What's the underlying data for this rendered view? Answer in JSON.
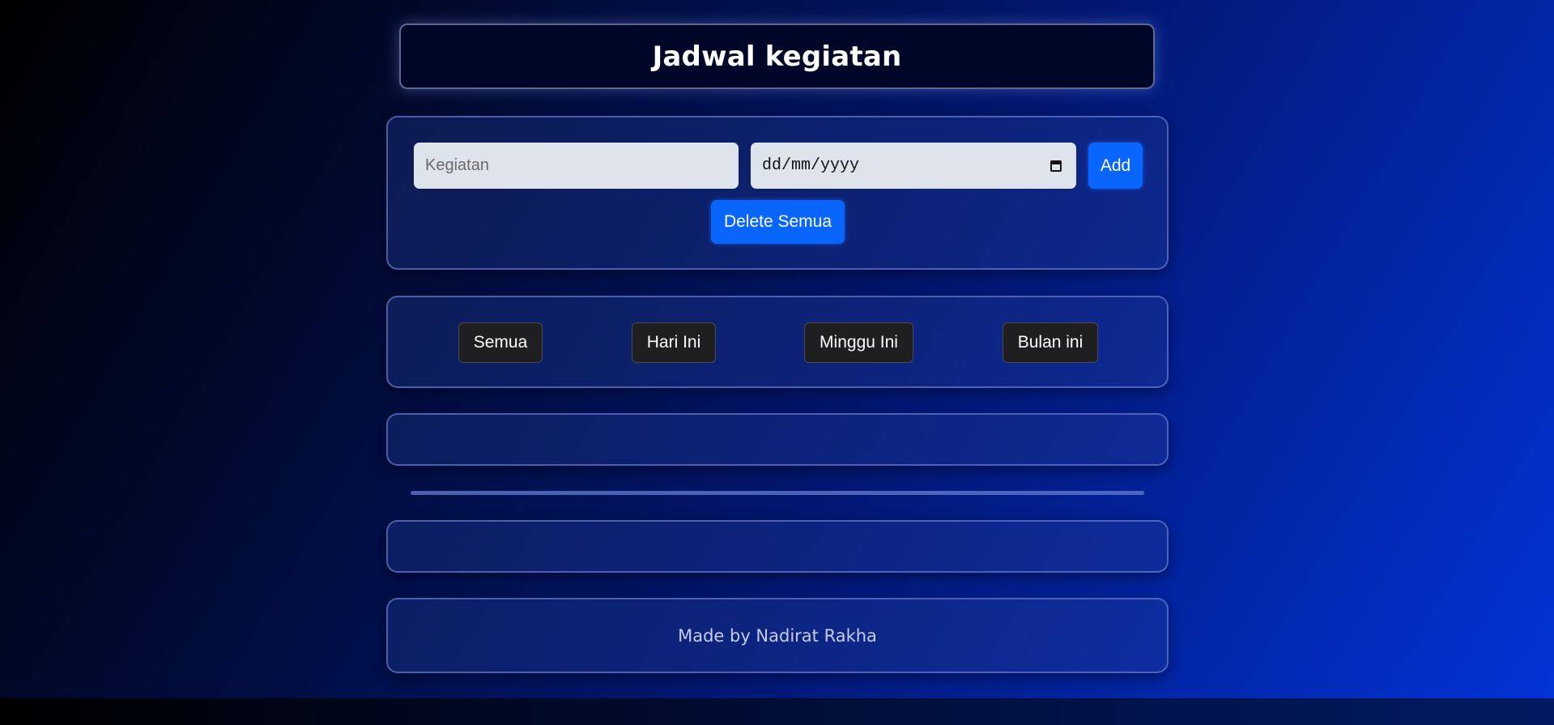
{
  "header": {
    "title": "Jadwal kegiatan"
  },
  "form": {
    "activity_placeholder": "Kegiatan",
    "date_placeholder": "dd/mm/yyyy",
    "add_label": "Add",
    "delete_all_label": "Delete Semua"
  },
  "filters": [
    {
      "label": "Semua"
    },
    {
      "label": "Hari Ini"
    },
    {
      "label": "Minggu Ini"
    },
    {
      "label": "Bulan ini"
    }
  ],
  "footer": {
    "text": "Made by Nadirat Rakha"
  },
  "colors": {
    "accent": "#0866ff",
    "filter_button": "#1f1f22",
    "title_bg": "#000627"
  },
  "icons": {
    "date_picker": "calendar-icon"
  }
}
